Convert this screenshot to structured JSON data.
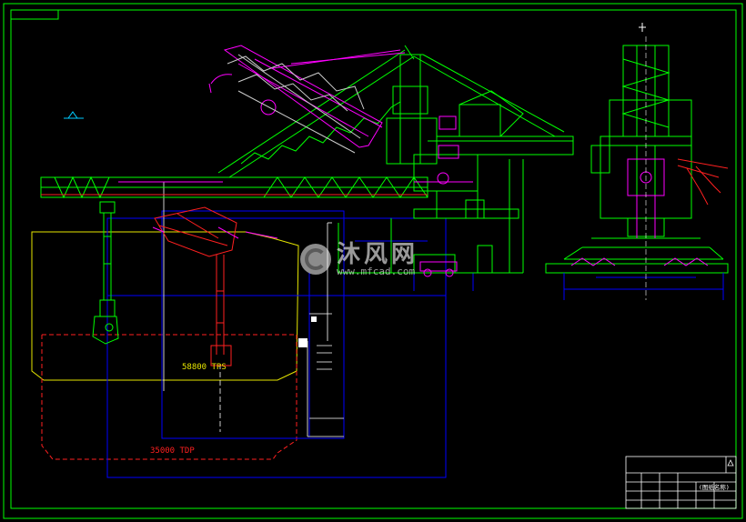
{
  "labels": {
    "capacity_upper": "58800 TPS",
    "capacity_lower": "35000 TDP"
  },
  "watermark": {
    "cn": "沐风网",
    "url": "www.mfcad.com"
  },
  "title_block": {
    "drawing_name": "(图纸名称)"
  },
  "colors": {
    "background": "#000000",
    "frame": "#00ff00",
    "boom": "#00ff00",
    "bucket_wheel": "#ff00ff",
    "hull_upper": "#e6e600",
    "hull_lower": "#ff0000",
    "chute": "#ff2020",
    "dimension": "#0000ff",
    "center_line": "#ffffff"
  }
}
